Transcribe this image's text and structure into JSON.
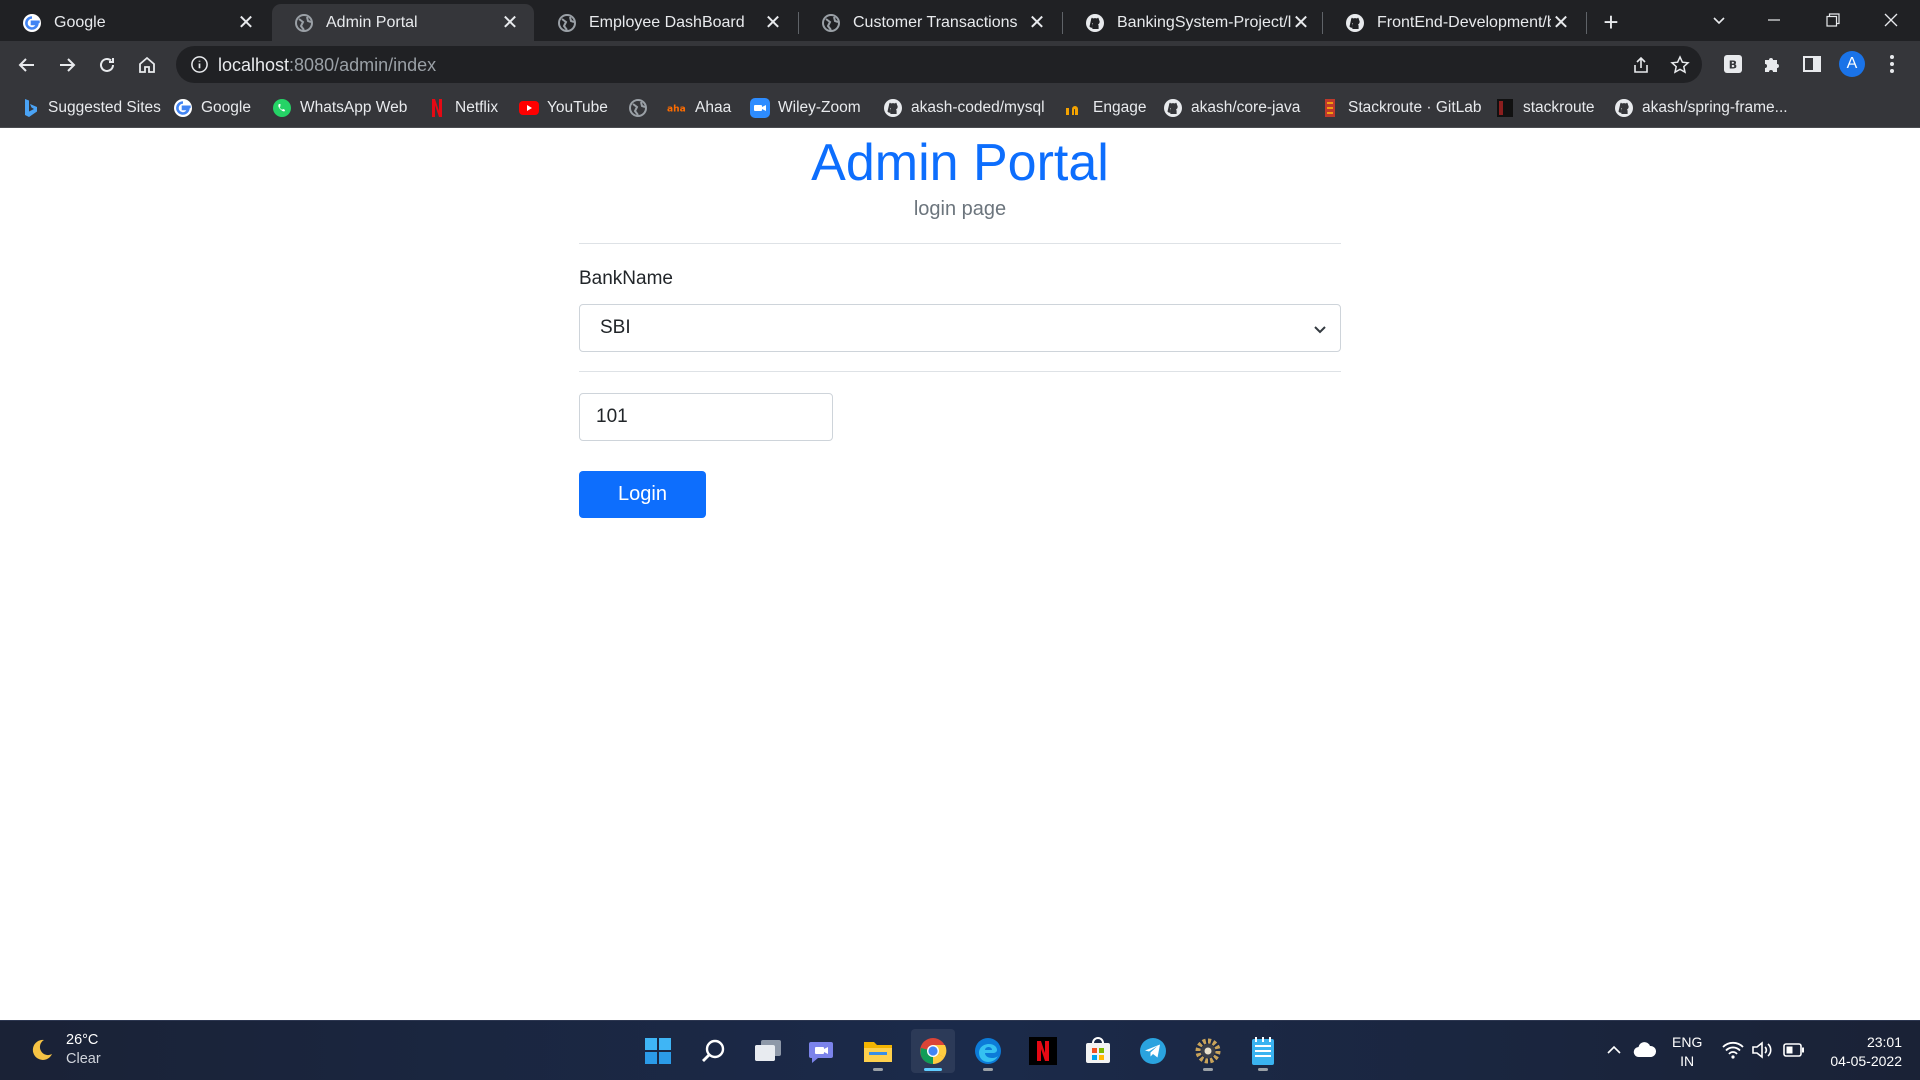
{
  "browser": {
    "tabs": [
      {
        "title": "Google",
        "icon": "google-icon",
        "active": false
      },
      {
        "title": "Admin Portal",
        "icon": "globe-icon",
        "active": true
      },
      {
        "title": "Employee DashBoard",
        "icon": "globe-icon",
        "active": false
      },
      {
        "title": "Customer Transactions",
        "icon": "globe-icon",
        "active": false
      },
      {
        "title": "BankingSystem-Project/list",
        "icon": "github-icon",
        "active": false
      },
      {
        "title": "FrontEnd-Development/bo",
        "icon": "github-icon",
        "active": false
      }
    ],
    "address": {
      "host": "localhost",
      "path": ":8080/admin/index"
    },
    "profile_initial": "A",
    "bookmarks": [
      {
        "label": "Suggested Sites",
        "icon": "bing-icon"
      },
      {
        "label": "Google",
        "icon": "google-icon"
      },
      {
        "label": "WhatsApp Web",
        "icon": "whatsapp-icon"
      },
      {
        "label": "Netflix",
        "icon": "netflix-icon"
      },
      {
        "label": "YouTube",
        "icon": "youtube-icon"
      },
      {
        "label": "",
        "icon": "globe-icon"
      },
      {
        "label": "Ahaa",
        "icon": "aha-icon"
      },
      {
        "label": "Wiley-Zoom",
        "icon": "zoom-icon"
      },
      {
        "label": "akash-coded/mysql",
        "icon": "github-icon"
      },
      {
        "label": "Engage",
        "icon": "engage-icon"
      },
      {
        "label": "akash/core-java",
        "icon": "github-icon"
      },
      {
        "label": "Stackroute · GitLab",
        "icon": "gitlab-icon"
      },
      {
        "label": "stackroute",
        "icon": "stackroute-icon"
      },
      {
        "label": "akash/spring-frame...",
        "icon": "github-icon"
      }
    ]
  },
  "page": {
    "title": "Admin Portal",
    "subtitle": "login page",
    "bank_label": "BankName",
    "bank_selected": "SBI",
    "id_value": "101",
    "login_label": "Login",
    "accent_color": "#0d6efd"
  },
  "taskbar": {
    "weather": {
      "temp": "26°C",
      "desc": "Clear"
    },
    "lang": {
      "line1": "ENG",
      "line2": "IN"
    },
    "clock": {
      "time": "23:01",
      "date": "04-05-2022"
    },
    "apps": [
      "windows-start-icon",
      "search-icon",
      "task-view-icon",
      "teams-chat-icon",
      "file-explorer-icon",
      "chrome-icon",
      "edge-icon",
      "netflix-icon",
      "microsoft-store-icon",
      "telegram-icon",
      "settings-icon",
      "notepad-icon"
    ]
  }
}
